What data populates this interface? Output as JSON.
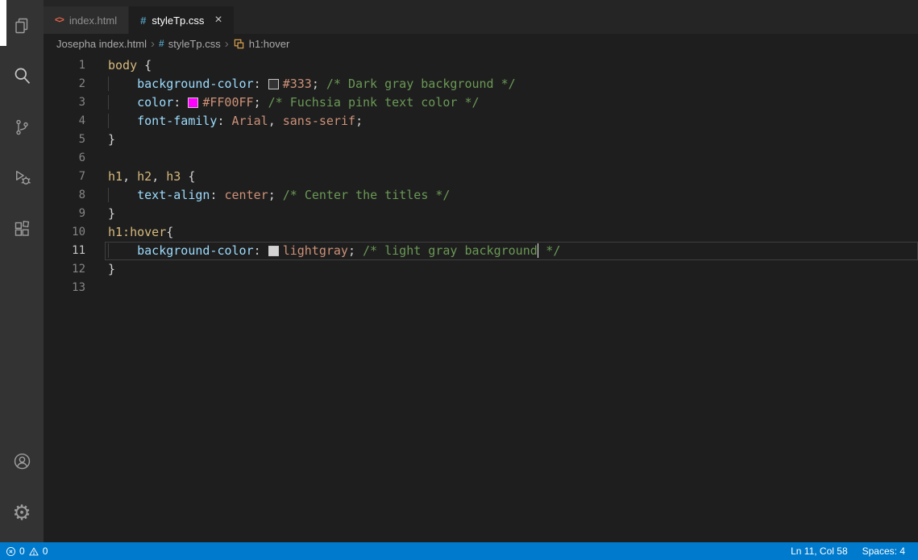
{
  "activity_bar": {
    "top_icons": [
      {
        "id": "explorer-icon"
      },
      {
        "id": "search-icon"
      },
      {
        "id": "source-control-icon"
      },
      {
        "id": "run-debug-icon"
      },
      {
        "id": "extensions-icon"
      }
    ],
    "bottom_icons": [
      {
        "id": "account-icon"
      },
      {
        "id": "settings-gear-icon"
      }
    ],
    "settings_glyph": "⚙"
  },
  "tabs": [
    {
      "label": "index.html",
      "icon": "html-file-icon",
      "icon_glyph": "<>",
      "active": false
    },
    {
      "label": "styleTp.css",
      "icon": "css-file-icon",
      "icon_glyph": "#",
      "active": true,
      "close_glyph": "×"
    }
  ],
  "breadcrumb": {
    "separator": "›",
    "items": [
      {
        "label": "Josepha index.html"
      },
      {
        "label": "styleTp.css",
        "icon": "css-symbol-icon",
        "icon_glyph": "#"
      },
      {
        "label": "h1:hover",
        "icon": "css-rule-symbol-icon"
      }
    ]
  },
  "editor": {
    "language": "css",
    "current_line": 11,
    "lines": [
      {
        "number": 1,
        "tokens": [
          {
            "c": "sel",
            "t": "body"
          },
          {
            "c": "pun",
            "t": " {"
          }
        ]
      },
      {
        "number": 2,
        "tokens": [
          {
            "c": "ind",
            "t": "    "
          },
          {
            "c": "prop",
            "t": "background-color"
          },
          {
            "c": "pun",
            "t": ": "
          },
          {
            "c": "swatch",
            "color": "#333333"
          },
          {
            "c": "val",
            "t": "#333"
          },
          {
            "c": "pun",
            "t": "; "
          },
          {
            "c": "com",
            "t": "/* Dark gray background */"
          }
        ]
      },
      {
        "number": 3,
        "tokens": [
          {
            "c": "ind",
            "t": "    "
          },
          {
            "c": "prop",
            "t": "color"
          },
          {
            "c": "pun",
            "t": ": "
          },
          {
            "c": "swatch",
            "color": "#FF00FF"
          },
          {
            "c": "val",
            "t": "#FF00FF"
          },
          {
            "c": "pun",
            "t": "; "
          },
          {
            "c": "com",
            "t": "/* Fuchsia pink text color */"
          }
        ]
      },
      {
        "number": 4,
        "tokens": [
          {
            "c": "ind",
            "t": "    "
          },
          {
            "c": "prop",
            "t": "font-family"
          },
          {
            "c": "pun",
            "t": ": "
          },
          {
            "c": "val",
            "t": "Arial"
          },
          {
            "c": "pun",
            "t": ", "
          },
          {
            "c": "val",
            "t": "sans-serif"
          },
          {
            "c": "pun",
            "t": ";"
          }
        ]
      },
      {
        "number": 5,
        "tokens": [
          {
            "c": "pun",
            "t": "}"
          }
        ]
      },
      {
        "number": 6,
        "tokens": []
      },
      {
        "number": 7,
        "tokens": [
          {
            "c": "sel",
            "t": "h1"
          },
          {
            "c": "pun",
            "t": ", "
          },
          {
            "c": "sel",
            "t": "h2"
          },
          {
            "c": "pun",
            "t": ", "
          },
          {
            "c": "sel",
            "t": "h3"
          },
          {
            "c": "pun",
            "t": " {"
          }
        ]
      },
      {
        "number": 8,
        "tokens": [
          {
            "c": "ind",
            "t": "    "
          },
          {
            "c": "prop",
            "t": "text-align"
          },
          {
            "c": "pun",
            "t": ": "
          },
          {
            "c": "val",
            "t": "center"
          },
          {
            "c": "pun",
            "t": "; "
          },
          {
            "c": "com",
            "t": "/* Center the titles */"
          }
        ]
      },
      {
        "number": 9,
        "tokens": [
          {
            "c": "pun",
            "t": "}"
          }
        ]
      },
      {
        "number": 10,
        "tokens": [
          {
            "c": "sel",
            "t": "h1:hover"
          },
          {
            "c": "pun",
            "t": "{"
          }
        ]
      },
      {
        "number": 11,
        "tokens": [
          {
            "c": "ind",
            "t": "    "
          },
          {
            "c": "prop",
            "t": "background-color"
          },
          {
            "c": "pun",
            "t": ": "
          },
          {
            "c": "swatch",
            "color": "#d3d3d3"
          },
          {
            "c": "val",
            "t": "lightgray"
          },
          {
            "c": "pun",
            "t": "; "
          },
          {
            "c": "com",
            "t": "/* light gray background"
          },
          {
            "c": "cursor"
          },
          {
            "c": "com",
            "t": " */"
          }
        ]
      },
      {
        "number": 12,
        "tokens": [
          {
            "c": "pun",
            "t": "}"
          }
        ]
      },
      {
        "number": 13,
        "tokens": []
      }
    ]
  },
  "status_bar": {
    "errors": "0",
    "warnings": "0",
    "line_col": "Ln 11, Col 58",
    "spaces": "Spaces: 4"
  },
  "colors": {
    "accent": "#007acc",
    "activity_bar_bg": "#333333",
    "editor_bg": "#1e1e1e",
    "tabbar_bg": "#252526",
    "selector": "#d7ba7d",
    "property": "#9cdcfe",
    "value": "#ce9178",
    "comment": "#6a9955",
    "punctuation": "#d4d4d4"
  }
}
